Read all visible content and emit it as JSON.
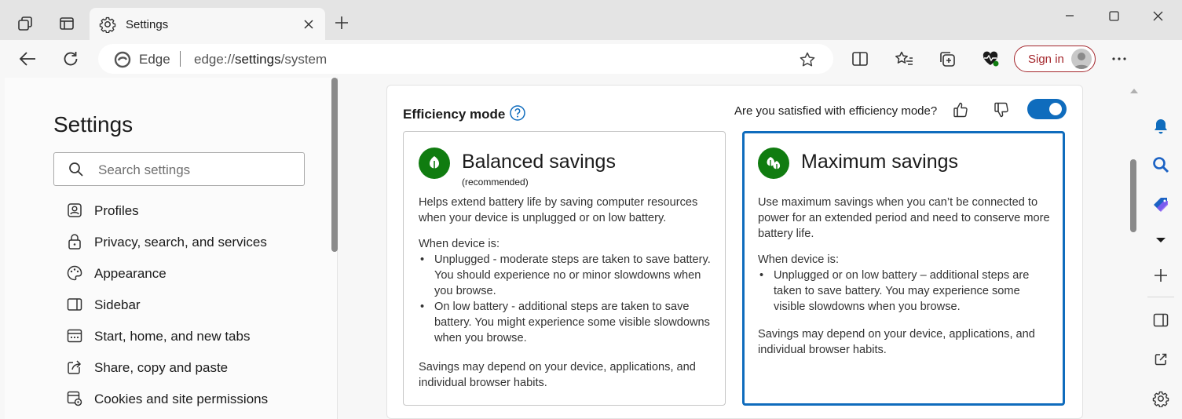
{
  "tab": {
    "title": "Settings"
  },
  "addressbar": {
    "brand": "Edge",
    "url_prefix": "edge://",
    "url_path": "settings",
    "url_suffix": "/system"
  },
  "toolbar": {
    "signin_label": "Sign in"
  },
  "settings": {
    "title": "Settings",
    "search_placeholder": "Search settings",
    "nav": [
      {
        "label": "Profiles",
        "icon": "profiles-icon"
      },
      {
        "label": "Privacy, search, and services",
        "icon": "lock-icon"
      },
      {
        "label": "Appearance",
        "icon": "palette-icon"
      },
      {
        "label": "Sidebar",
        "icon": "sidebar-icon"
      },
      {
        "label": "Start, home, and new tabs",
        "icon": "home-tabs-icon"
      },
      {
        "label": "Share, copy and paste",
        "icon": "share-icon"
      },
      {
        "label": "Cookies and site permissions",
        "icon": "cookies-icon"
      }
    ]
  },
  "efficiency": {
    "title": "Efficiency mode",
    "feedback_question": "Are you satisfied with efficiency mode?",
    "enabled": true,
    "balanced": {
      "title": "Balanced savings",
      "subtitle": "(recommended)",
      "description": "Helps extend battery life by saving computer resources when your device is unplugged or on low battery.",
      "when_label": "When device is:",
      "bullets": [
        "Unplugged - moderate steps are taken to save battery. You should experience no or minor slowdowns when you browse.",
        "On low battery - additional steps are taken to save battery. You might experience some visible slowdowns when you browse."
      ],
      "footer": "Savings may depend on your device, applications, and individual browser habits."
    },
    "maximum": {
      "title": "Maximum savings",
      "description": "Use maximum savings when you can’t be connected to power for an extended period and need to conserve more battery life.",
      "when_label": "When device is:",
      "bullets": [
        "Unplugged or on low battery – additional steps are taken to save battery. You may experience some visible slowdowns when you browse."
      ],
      "footer": "Savings may depend on your device, applications, and individual browser habits.",
      "selected": true
    }
  },
  "colors": {
    "accent": "#0f6cbd",
    "leaf_green": "#107c10",
    "signin_red": "#a4262c"
  }
}
